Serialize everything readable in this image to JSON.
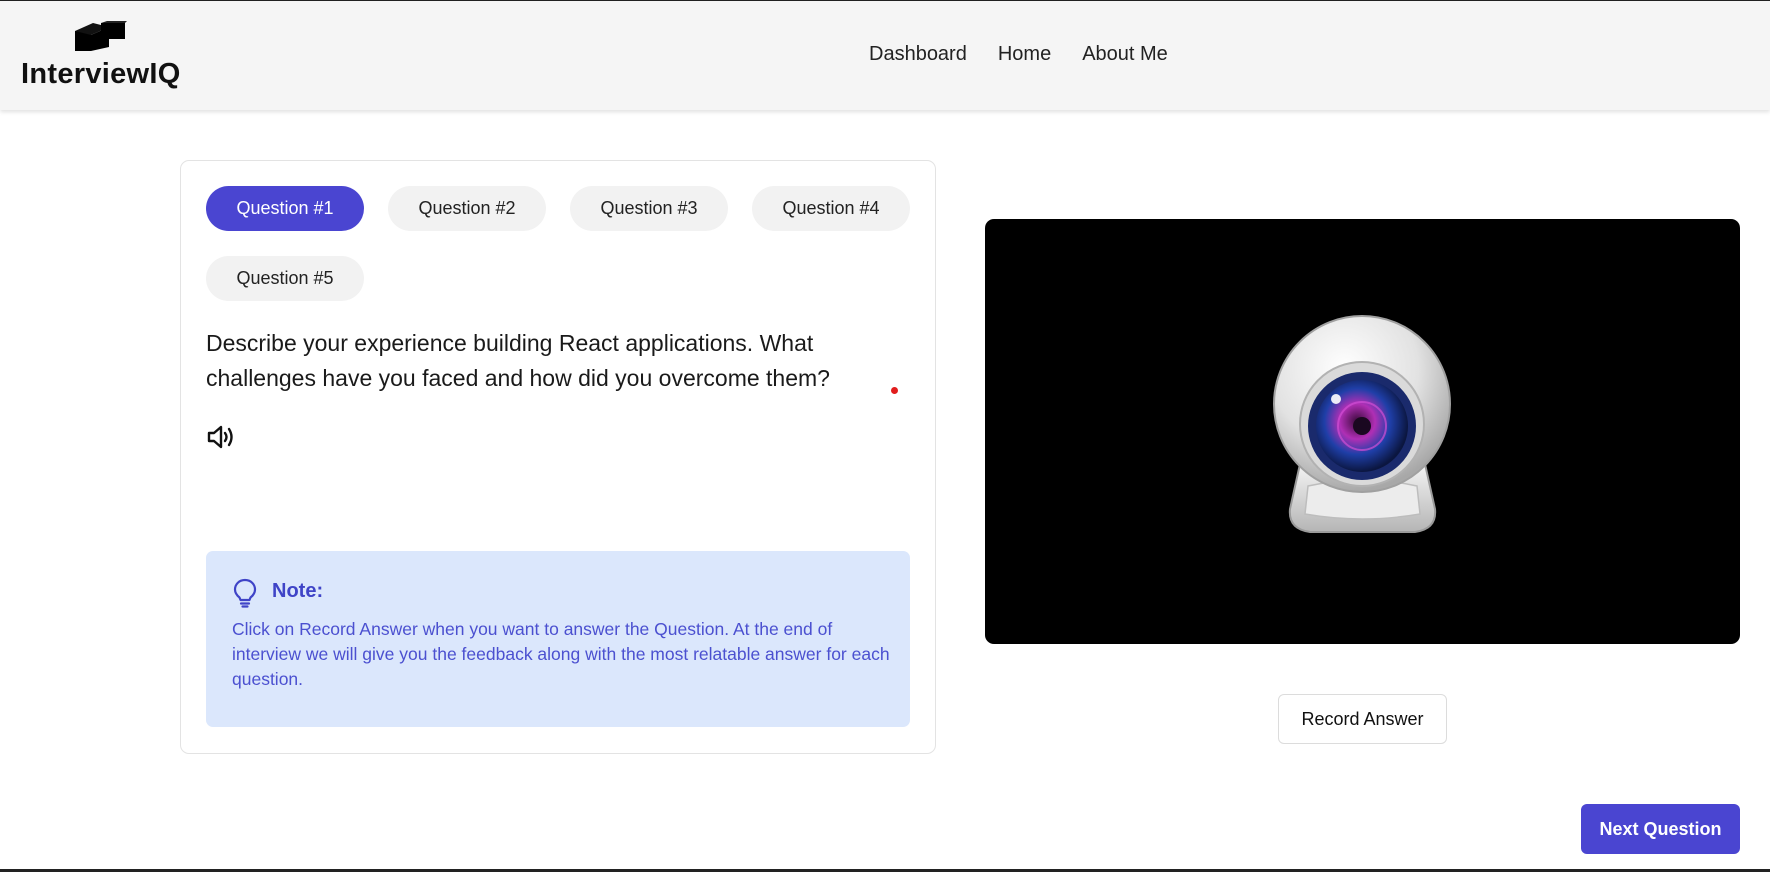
{
  "app": {
    "logo_text": "InterviewIQ",
    "accent_color": "#4a45d1"
  },
  "nav": {
    "items": [
      "Dashboard",
      "Home",
      "About Me"
    ]
  },
  "questions": {
    "tabs": [
      "Question #1",
      "Question #2",
      "Question #3",
      "Question #4",
      "Question #5"
    ],
    "active_index": 0,
    "current_text": "Describe your experience building React applications. What challenges have you faced and how did you overcome them?"
  },
  "note": {
    "title": "Note:",
    "text": "Click on Record Answer when you want to answer the Question. At the end of interview we will give you the feedback along with the most relatable answer for each question.",
    "icon": "lightbulb-icon",
    "background": "#dbe7fc"
  },
  "camera": {
    "icon": "webcam-icon"
  },
  "actions": {
    "record_label": "Record Answer",
    "next_label": "Next Question"
  }
}
